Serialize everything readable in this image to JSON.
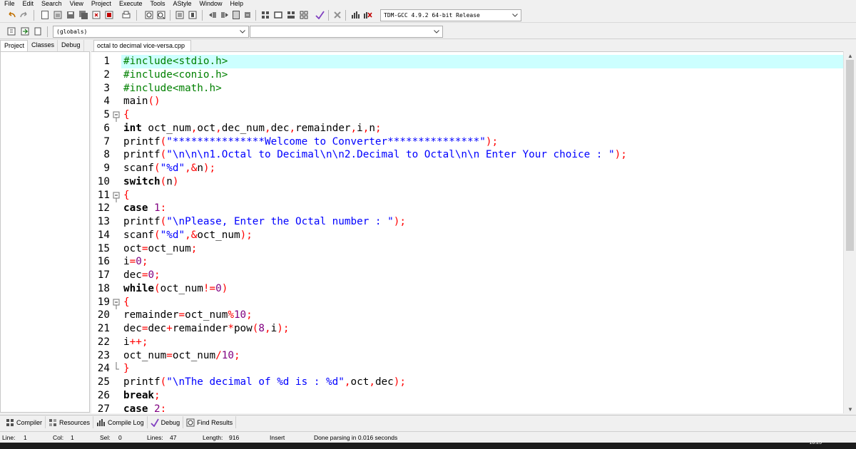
{
  "menu": [
    "File",
    "Edit",
    "Search",
    "View",
    "Project",
    "Execute",
    "Tools",
    "AStyle",
    "Window",
    "Help"
  ],
  "toolbar": {
    "compiler_select": "TDM-GCC 4.9.2 64-bit Release",
    "scope_select": "(globals)",
    "function_select": ""
  },
  "side_tabs": [
    "Project",
    "Classes",
    "Debug"
  ],
  "file_tab": "octal to decimal vice-versa.cpp",
  "code_lines": [
    {
      "n": "1",
      "text": "#include<stdio.h>"
    },
    {
      "n": "2",
      "text": "#include<conio.h>"
    },
    {
      "n": "3",
      "text": "#include<math.h>"
    },
    {
      "n": "4",
      "text": "main()"
    },
    {
      "n": "5",
      "text": "{"
    },
    {
      "n": "6",
      "text": "int oct_num,oct,dec_num,dec,remainder,i,n;"
    },
    {
      "n": "7",
      "text": "printf(\"***************Welcome to Converter***************\");"
    },
    {
      "n": "8",
      "text": "printf(\"\\n\\n\\n1.Octal to Decimal\\n\\n2.Decimal to Octal\\n\\n Enter Your choice : \");"
    },
    {
      "n": "9",
      "text": "scanf(\"%d\",&n);"
    },
    {
      "n": "10",
      "text": "switch(n)"
    },
    {
      "n": "11",
      "text": "{"
    },
    {
      "n": "12",
      "text": "case 1:"
    },
    {
      "n": "13",
      "text": "printf(\"\\nPlease, Enter the Octal number : \");"
    },
    {
      "n": "14",
      "text": "scanf(\"%d\",&oct_num);"
    },
    {
      "n": "15",
      "text": "oct=oct_num;"
    },
    {
      "n": "16",
      "text": "i=0;"
    },
    {
      "n": "17",
      "text": "dec=0;"
    },
    {
      "n": "18",
      "text": "while(oct_num!=0)"
    },
    {
      "n": "19",
      "text": "{"
    },
    {
      "n": "20",
      "text": "remainder=oct_num%10;"
    },
    {
      "n": "21",
      "text": "dec=dec+remainder*pow(8,i);"
    },
    {
      "n": "22",
      "text": "i++;"
    },
    {
      "n": "23",
      "text": "oct_num=oct_num/10;"
    },
    {
      "n": "24",
      "text": "}"
    },
    {
      "n": "25",
      "text": "printf(\"\\nThe decimal of %d is : %d\",oct,dec);"
    },
    {
      "n": "26",
      "text": "break;"
    },
    {
      "n": "27",
      "text": "case 2:"
    }
  ],
  "bottom_tabs": [
    {
      "label": "Compiler",
      "icon": "compiler-icon"
    },
    {
      "label": "Resources",
      "icon": "resources-icon"
    },
    {
      "label": "Compile Log",
      "icon": "compile-log-icon"
    },
    {
      "label": "Debug",
      "icon": "debug-icon"
    },
    {
      "label": "Find Results",
      "icon": "find-results-icon"
    }
  ],
  "status": {
    "line_label": "Line:",
    "line": "1",
    "col_label": "Col:",
    "col": "1",
    "sel_label": "Sel:",
    "sel": "0",
    "lines_label": "Lines:",
    "lines": "47",
    "length_label": "Length:",
    "length": "916",
    "mode": "Insert",
    "message": "Done parsing in 0.016 seconds"
  },
  "taskbar": {
    "clock": "16:25"
  },
  "colors": {
    "highlight_line": "#ccffff",
    "string": "#0000ff",
    "operator": "#ff0000",
    "number": "#800080",
    "preprocessor": "#008000"
  }
}
